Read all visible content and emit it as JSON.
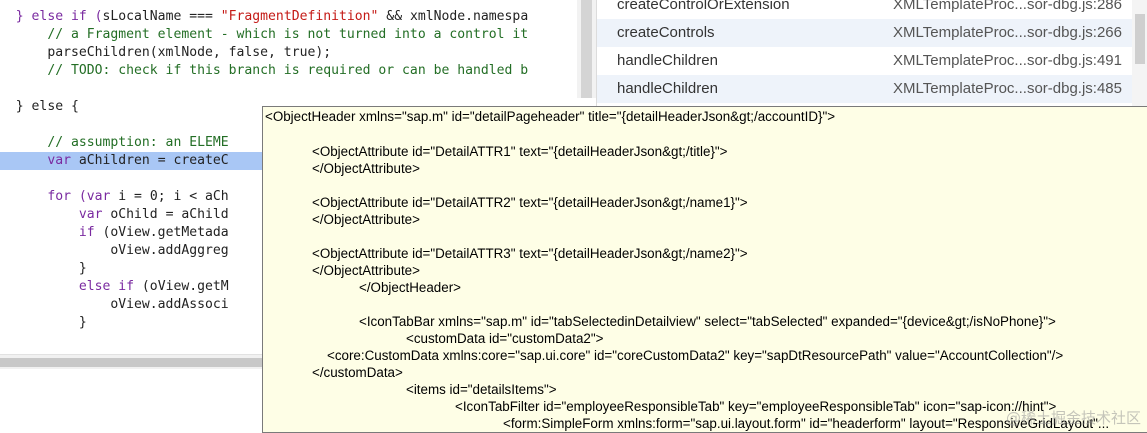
{
  "editor": {
    "lines": [
      {
        "ind": "  ",
        "t": [
          [
            "kw",
            "} else if ("
          ],
          [
            "id",
            "sLocalName === "
          ],
          [
            "str",
            "\"FragmentDefinition\""
          ],
          [
            "id",
            " && xmlNode.namespa"
          ]
        ]
      },
      {
        "ind": "      ",
        "t": [
          [
            "cm",
            "// a Fragment element - which is not turned into a control it"
          ]
        ]
      },
      {
        "ind": "      ",
        "t": [
          [
            "id",
            "parseChildren(xmlNode, false, true);"
          ]
        ]
      },
      {
        "ind": "      ",
        "t": [
          [
            "cm",
            "// TODO: check if this branch is required or can be handled b"
          ]
        ]
      },
      {
        "ind": "",
        "t": []
      },
      {
        "ind": "  ",
        "t": [
          [
            "id",
            "} else {"
          ]
        ]
      },
      {
        "ind": "",
        "t": []
      },
      {
        "ind": "      ",
        "t": [
          [
            "cm",
            "// assumption: an ELEME"
          ]
        ]
      },
      {
        "ind": "      ",
        "t": [
          [
            "kw",
            "var "
          ],
          [
            "id",
            "aChildren = createC"
          ]
        ],
        "highlight": true
      },
      {
        "ind": "",
        "t": []
      },
      {
        "ind": "      ",
        "t": [
          [
            "kw",
            "for ("
          ],
          [
            "kw",
            "var "
          ],
          [
            "id",
            "i = 0; i < aCh"
          ]
        ]
      },
      {
        "ind": "          ",
        "t": [
          [
            "kw",
            "var "
          ],
          [
            "id",
            "oChild = aChild"
          ]
        ]
      },
      {
        "ind": "          ",
        "t": [
          [
            "kw",
            "if "
          ],
          [
            "id",
            "(oView.getMetada"
          ]
        ]
      },
      {
        "ind": "              ",
        "t": [
          [
            "id",
            "oView.addAggreg"
          ]
        ]
      },
      {
        "ind": "          ",
        "t": [
          [
            "id",
            "}"
          ]
        ]
      },
      {
        "ind": "          ",
        "t": [
          [
            "kw",
            "else if "
          ],
          [
            "id",
            "(oView.getM"
          ]
        ]
      },
      {
        "ind": "              ",
        "t": [
          [
            "id",
            "oView.addAssoci"
          ]
        ]
      },
      {
        "ind": "          ",
        "t": [
          [
            "id",
            "}"
          ]
        ]
      }
    ]
  },
  "callstack": {
    "frames": [
      {
        "fn": "createControlOrExtension",
        "loc": "XMLTemplateProc...sor-dbg.js:286"
      },
      {
        "fn": "createControls",
        "loc": "XMLTemplateProc...sor-dbg.js:266"
      },
      {
        "fn": "handleChildren",
        "loc": "XMLTemplateProc...sor-dbg.js:491"
      },
      {
        "fn": "handleChildren",
        "loc": "XMLTemplateProc...sor-dbg.js:485"
      }
    ]
  },
  "popover": {
    "lines": [
      "<ObjectHeader xmlns=\"sap.m\" id=\"detailPageheader\" title=\"{detailHeaderJson&gt;/accountID}\">",
      "",
      "<ObjectAttribute id=\"DetailATTR1\" text=\"{detailHeaderJson&gt;/title}\">",
      "</ObjectAttribute>",
      "",
      "<ObjectAttribute id=\"DetailATTR2\" text=\"{detailHeaderJson&gt;/name1}\">",
      "</ObjectAttribute>",
      "",
      "<ObjectAttribute id=\"DetailATTR3\" text=\"{detailHeaderJson&gt;/name2}\">",
      "</ObjectAttribute>",
      "</ObjectHeader>",
      "",
      "<IconTabBar xmlns=\"sap.m\" id=\"tabSelectedinDetailview\" select=\"tabSelected\" expanded=\"{device&gt;/isNoPhone}\">",
      "<customData id=\"customData2\">",
      "<core:CustomData xmlns:core=\"sap.ui.core\" id=\"coreCustomData2\" key=\"sapDtResourcePath\" value=\"AccountCollection\"/>",
      "</customData>",
      "<items id=\"detailsItems\">",
      "<IconTabFilter id=\"employeeResponsibleTab\" key=\"employeeResponsibleTab\" icon=\"sap-icon://hint\">",
      "<form:SimpleForm xmlns:form=\"sap.ui.layout.form\" id=\"headerform\" layout=\"ResponsiveGridLayout\"..."
    ],
    "watermark": "@稀土掘金技术社区"
  }
}
